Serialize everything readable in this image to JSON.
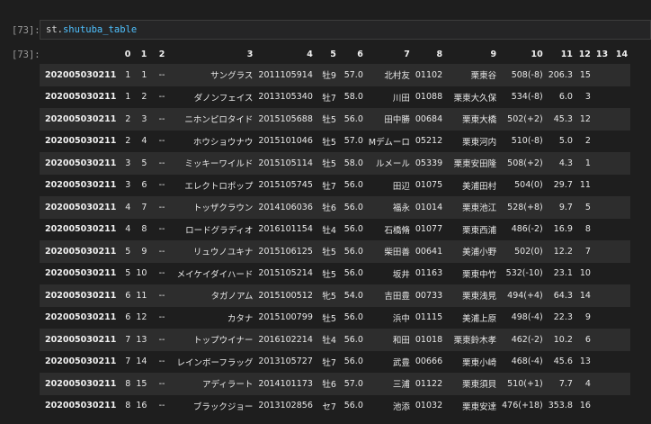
{
  "notebook": {
    "in_prompt": "[73]:",
    "out_prompt": "[73]:",
    "code": {
      "var": "st",
      "dot": ".",
      "attr": "shutuba_table"
    }
  },
  "table": {
    "columns": [
      "",
      "0",
      "1",
      "2",
      "3",
      "4",
      "5",
      "6",
      "7",
      "8",
      "9",
      "10",
      "11",
      "12",
      "13",
      "14"
    ],
    "rows": [
      [
        "202005030211",
        "1",
        "1",
        "--",
        "サングラス",
        "2011105914",
        "牡9",
        "57.0",
        "北村友",
        "01102",
        "栗東谷",
        "508(-8)",
        "206.3",
        "15",
        "",
        ""
      ],
      [
        "202005030211",
        "1",
        "2",
        "--",
        "ダノンフェイス",
        "2013105340",
        "牡7",
        "58.0",
        "川田",
        "01088",
        "栗東大久保",
        "534(-8)",
        "6.0",
        "3",
        "",
        ""
      ],
      [
        "202005030211",
        "2",
        "3",
        "--",
        "ニホンピロタイド",
        "2015105688",
        "牡5",
        "56.0",
        "田中勝",
        "00684",
        "栗東大橋",
        "502(+2)",
        "45.3",
        "12",
        "",
        ""
      ],
      [
        "202005030211",
        "2",
        "4",
        "--",
        "ホウショウナウ",
        "2015101046",
        "牡5",
        "57.0",
        "Mデムーロ",
        "05212",
        "栗東河内",
        "510(-8)",
        "5.0",
        "2",
        "",
        ""
      ],
      [
        "202005030211",
        "3",
        "5",
        "--",
        "ミッキーワイルド",
        "2015105114",
        "牡5",
        "58.0",
        "ルメール",
        "05339",
        "栗東安田隆",
        "508(+2)",
        "4.3",
        "1",
        "",
        ""
      ],
      [
        "202005030211",
        "3",
        "6",
        "--",
        "エレクトロポップ",
        "2015105745",
        "牡7",
        "56.0",
        "田辺",
        "01075",
        "美浦田村",
        "504(0)",
        "29.7",
        "11",
        "",
        ""
      ],
      [
        "202005030211",
        "4",
        "7",
        "--",
        "トッザクラウン",
        "2014106036",
        "牡6",
        "56.0",
        "福永",
        "01014",
        "栗東池江",
        "528(+8)",
        "9.7",
        "5",
        "",
        ""
      ],
      [
        "202005030211",
        "4",
        "8",
        "--",
        "ロードグラディオ",
        "2016101154",
        "牡4",
        "56.0",
        "石橋脩",
        "01077",
        "栗東西浦",
        "486(-2)",
        "16.9",
        "8",
        "",
        ""
      ],
      [
        "202005030211",
        "5",
        "9",
        "--",
        "リュウノユキナ",
        "2015106125",
        "牡5",
        "56.0",
        "柴田善",
        "00641",
        "美浦小野",
        "502(0)",
        "12.2",
        "7",
        "",
        ""
      ],
      [
        "202005030211",
        "5",
        "10",
        "--",
        "メイケイダイハード",
        "2015105214",
        "牡5",
        "56.0",
        "坂井",
        "01163",
        "栗東中竹",
        "532(-10)",
        "23.1",
        "10",
        "",
        ""
      ],
      [
        "202005030211",
        "6",
        "11",
        "--",
        "タガノアム",
        "2015100512",
        "牝5",
        "54.0",
        "吉田豊",
        "00733",
        "栗東浅見",
        "494(+4)",
        "64.3",
        "14",
        "",
        ""
      ],
      [
        "202005030211",
        "6",
        "12",
        "--",
        "カタナ",
        "2015100799",
        "牡5",
        "56.0",
        "浜中",
        "01115",
        "美浦上原",
        "498(-4)",
        "22.3",
        "9",
        "",
        ""
      ],
      [
        "202005030211",
        "7",
        "13",
        "--",
        "トップウイナー",
        "2016102214",
        "牡4",
        "56.0",
        "和田",
        "01018",
        "栗東鈴木孝",
        "462(-2)",
        "10.2",
        "6",
        "",
        ""
      ],
      [
        "202005030211",
        "7",
        "14",
        "--",
        "レインボーフラッグ",
        "2013105727",
        "牡7",
        "56.0",
        "武豊",
        "00666",
        "栗東小崎",
        "468(-4)",
        "45.6",
        "13",
        "",
        ""
      ],
      [
        "202005030211",
        "8",
        "15",
        "--",
        "アディラート",
        "2014101173",
        "牡6",
        "57.0",
        "三浦",
        "01122",
        "栗東須貝",
        "510(+1)",
        "7.7",
        "4",
        "",
        ""
      ],
      [
        "202005030211",
        "8",
        "16",
        "--",
        "ブラックジョー",
        "2013102856",
        "セ7",
        "56.0",
        "池添",
        "01032",
        "栗東安達",
        "476(+18)",
        "353.8",
        "16",
        "",
        ""
      ]
    ]
  }
}
